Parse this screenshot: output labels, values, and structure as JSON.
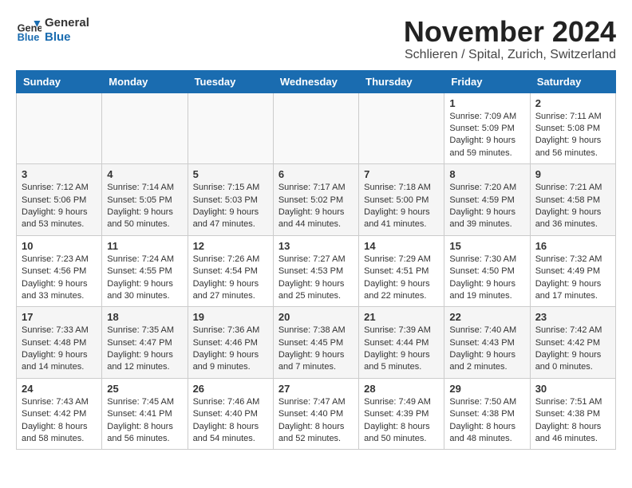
{
  "logo": {
    "line1": "General",
    "line2": "Blue"
  },
  "title": "November 2024",
  "subtitle": "Schlieren / Spital, Zurich, Switzerland",
  "days_of_week": [
    "Sunday",
    "Monday",
    "Tuesday",
    "Wednesday",
    "Thursday",
    "Friday",
    "Saturday"
  ],
  "weeks": [
    [
      {
        "day": "",
        "info": ""
      },
      {
        "day": "",
        "info": ""
      },
      {
        "day": "",
        "info": ""
      },
      {
        "day": "",
        "info": ""
      },
      {
        "day": "",
        "info": ""
      },
      {
        "day": "1",
        "info": "Sunrise: 7:09 AM\nSunset: 5:09 PM\nDaylight: 9 hours and 59 minutes."
      },
      {
        "day": "2",
        "info": "Sunrise: 7:11 AM\nSunset: 5:08 PM\nDaylight: 9 hours and 56 minutes."
      }
    ],
    [
      {
        "day": "3",
        "info": "Sunrise: 7:12 AM\nSunset: 5:06 PM\nDaylight: 9 hours and 53 minutes."
      },
      {
        "day": "4",
        "info": "Sunrise: 7:14 AM\nSunset: 5:05 PM\nDaylight: 9 hours and 50 minutes."
      },
      {
        "day": "5",
        "info": "Sunrise: 7:15 AM\nSunset: 5:03 PM\nDaylight: 9 hours and 47 minutes."
      },
      {
        "day": "6",
        "info": "Sunrise: 7:17 AM\nSunset: 5:02 PM\nDaylight: 9 hours and 44 minutes."
      },
      {
        "day": "7",
        "info": "Sunrise: 7:18 AM\nSunset: 5:00 PM\nDaylight: 9 hours and 41 minutes."
      },
      {
        "day": "8",
        "info": "Sunrise: 7:20 AM\nSunset: 4:59 PM\nDaylight: 9 hours and 39 minutes."
      },
      {
        "day": "9",
        "info": "Sunrise: 7:21 AM\nSunset: 4:58 PM\nDaylight: 9 hours and 36 minutes."
      }
    ],
    [
      {
        "day": "10",
        "info": "Sunrise: 7:23 AM\nSunset: 4:56 PM\nDaylight: 9 hours and 33 minutes."
      },
      {
        "day": "11",
        "info": "Sunrise: 7:24 AM\nSunset: 4:55 PM\nDaylight: 9 hours and 30 minutes."
      },
      {
        "day": "12",
        "info": "Sunrise: 7:26 AM\nSunset: 4:54 PM\nDaylight: 9 hours and 27 minutes."
      },
      {
        "day": "13",
        "info": "Sunrise: 7:27 AM\nSunset: 4:53 PM\nDaylight: 9 hours and 25 minutes."
      },
      {
        "day": "14",
        "info": "Sunrise: 7:29 AM\nSunset: 4:51 PM\nDaylight: 9 hours and 22 minutes."
      },
      {
        "day": "15",
        "info": "Sunrise: 7:30 AM\nSunset: 4:50 PM\nDaylight: 9 hours and 19 minutes."
      },
      {
        "day": "16",
        "info": "Sunrise: 7:32 AM\nSunset: 4:49 PM\nDaylight: 9 hours and 17 minutes."
      }
    ],
    [
      {
        "day": "17",
        "info": "Sunrise: 7:33 AM\nSunset: 4:48 PM\nDaylight: 9 hours and 14 minutes."
      },
      {
        "day": "18",
        "info": "Sunrise: 7:35 AM\nSunset: 4:47 PM\nDaylight: 9 hours and 12 minutes."
      },
      {
        "day": "19",
        "info": "Sunrise: 7:36 AM\nSunset: 4:46 PM\nDaylight: 9 hours and 9 minutes."
      },
      {
        "day": "20",
        "info": "Sunrise: 7:38 AM\nSunset: 4:45 PM\nDaylight: 9 hours and 7 minutes."
      },
      {
        "day": "21",
        "info": "Sunrise: 7:39 AM\nSunset: 4:44 PM\nDaylight: 9 hours and 5 minutes."
      },
      {
        "day": "22",
        "info": "Sunrise: 7:40 AM\nSunset: 4:43 PM\nDaylight: 9 hours and 2 minutes."
      },
      {
        "day": "23",
        "info": "Sunrise: 7:42 AM\nSunset: 4:42 PM\nDaylight: 9 hours and 0 minutes."
      }
    ],
    [
      {
        "day": "24",
        "info": "Sunrise: 7:43 AM\nSunset: 4:42 PM\nDaylight: 8 hours and 58 minutes."
      },
      {
        "day": "25",
        "info": "Sunrise: 7:45 AM\nSunset: 4:41 PM\nDaylight: 8 hours and 56 minutes."
      },
      {
        "day": "26",
        "info": "Sunrise: 7:46 AM\nSunset: 4:40 PM\nDaylight: 8 hours and 54 minutes."
      },
      {
        "day": "27",
        "info": "Sunrise: 7:47 AM\nSunset: 4:40 PM\nDaylight: 8 hours and 52 minutes."
      },
      {
        "day": "28",
        "info": "Sunrise: 7:49 AM\nSunset: 4:39 PM\nDaylight: 8 hours and 50 minutes."
      },
      {
        "day": "29",
        "info": "Sunrise: 7:50 AM\nSunset: 4:38 PM\nDaylight: 8 hours and 48 minutes."
      },
      {
        "day": "30",
        "info": "Sunrise: 7:51 AM\nSunset: 4:38 PM\nDaylight: 8 hours and 46 minutes."
      }
    ]
  ]
}
